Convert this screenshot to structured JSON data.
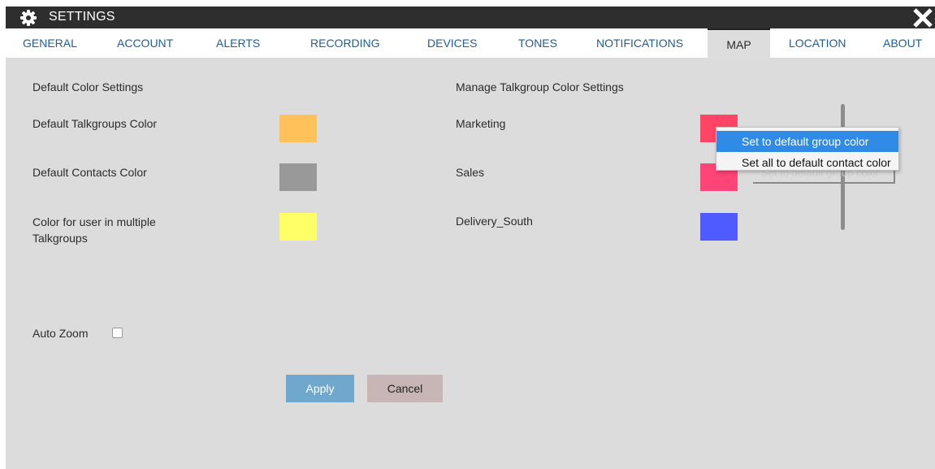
{
  "window": {
    "title": "SETTINGS",
    "icon": "gear-icon",
    "close_icon": "close-icon"
  },
  "tabs": [
    {
      "label": "GENERAL"
    },
    {
      "label": "ACCOUNT"
    },
    {
      "label": "ALERTS"
    },
    {
      "label": "RECORDING"
    },
    {
      "label": "DEVICES"
    },
    {
      "label": "TONES"
    },
    {
      "label": "NOTIFICATIONS"
    },
    {
      "label": "MAP",
      "active": true
    },
    {
      "label": "LOCATION"
    },
    {
      "label": "ABOUT"
    }
  ],
  "default_colors": {
    "heading": "Default Color Settings",
    "rows": [
      {
        "label": "Default Talkgroups Color",
        "color": "#ffc15a"
      },
      {
        "label": "Default Contacts Color",
        "color": "#999999"
      },
      {
        "label_line1": "Color for user in multiple",
        "label_line2": "Talkgroups",
        "color": "#ffff66"
      }
    ]
  },
  "talkgroup_colors": {
    "heading": "Manage Talkgroup Color Settings",
    "rows": [
      {
        "label": "Marketing",
        "color": "#ff4466"
      },
      {
        "label": "Sales",
        "color": "#ff4477"
      },
      {
        "label": "Delivery_South",
        "color": "#4f5bff"
      }
    ]
  },
  "auto_zoom": {
    "label": "Auto Zoom",
    "checked": false
  },
  "buttons": {
    "apply": "Apply",
    "cancel": "Cancel"
  },
  "context_menu": {
    "items": [
      {
        "label": "Set to default group color",
        "highlighted": true
      },
      {
        "label": "Set all to default contact color",
        "highlighted": false
      }
    ],
    "ghost_label": "Set to default group color"
  },
  "colors": {
    "titlebar": "#2e2e2e",
    "tab_text": "#1f5d96",
    "panel_bg": "#dcdcdc",
    "menu_highlight": "#2f8be6"
  }
}
